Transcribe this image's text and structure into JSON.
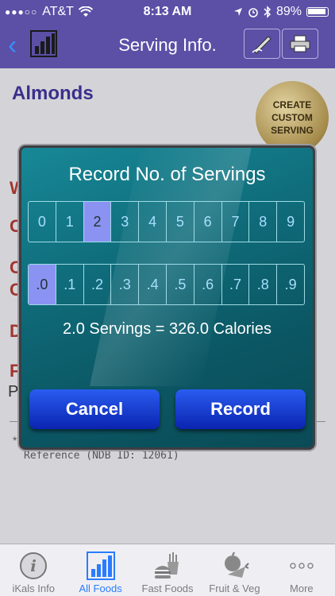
{
  "status_bar": {
    "carrier": "AT&T",
    "time": "8:13 AM",
    "battery": "89%"
  },
  "nav": {
    "title": "Serving Info."
  },
  "background": {
    "food_title": "Almonds",
    "seal_line1": "CREATE",
    "seal_line2": "CUSTOM",
    "seal_line3": "SERVING",
    "reference": "Reference (NDB ID: 12061)",
    "letters": [
      "W",
      "C",
      "C",
      "C",
      "D",
      "F"
    ],
    "partial_text": "P"
  },
  "modal": {
    "title": "Record No. of Servings",
    "whole_digits": [
      "0",
      "1",
      "2",
      "3",
      "4",
      "5",
      "6",
      "7",
      "8",
      "9"
    ],
    "selected_whole": "2",
    "decimal_digits": [
      ".0",
      ".1",
      ".2",
      ".3",
      ".4",
      ".5",
      ".6",
      ".7",
      ".8",
      ".9"
    ],
    "selected_decimal": ".0",
    "result": "2.0 Servings = 326.0 Calories",
    "cancel_label": "Cancel",
    "record_label": "Record"
  },
  "tabs": [
    {
      "label": "iKals Info",
      "icon": "info-icon"
    },
    {
      "label": "All Foods",
      "icon": "bar-chart-icon"
    },
    {
      "label": "Fast Foods",
      "icon": "burger-fries-icon"
    },
    {
      "label": "Fruit & Veg",
      "icon": "apple-carrot-icon"
    },
    {
      "label": "More",
      "icon": "more-dots-icon"
    }
  ],
  "colors": {
    "nav_bg": "#5b4fa6",
    "modal_bg": "#0f6a78",
    "accent_blue": "#2a7cff",
    "selected_cell": "#8b93f2"
  }
}
